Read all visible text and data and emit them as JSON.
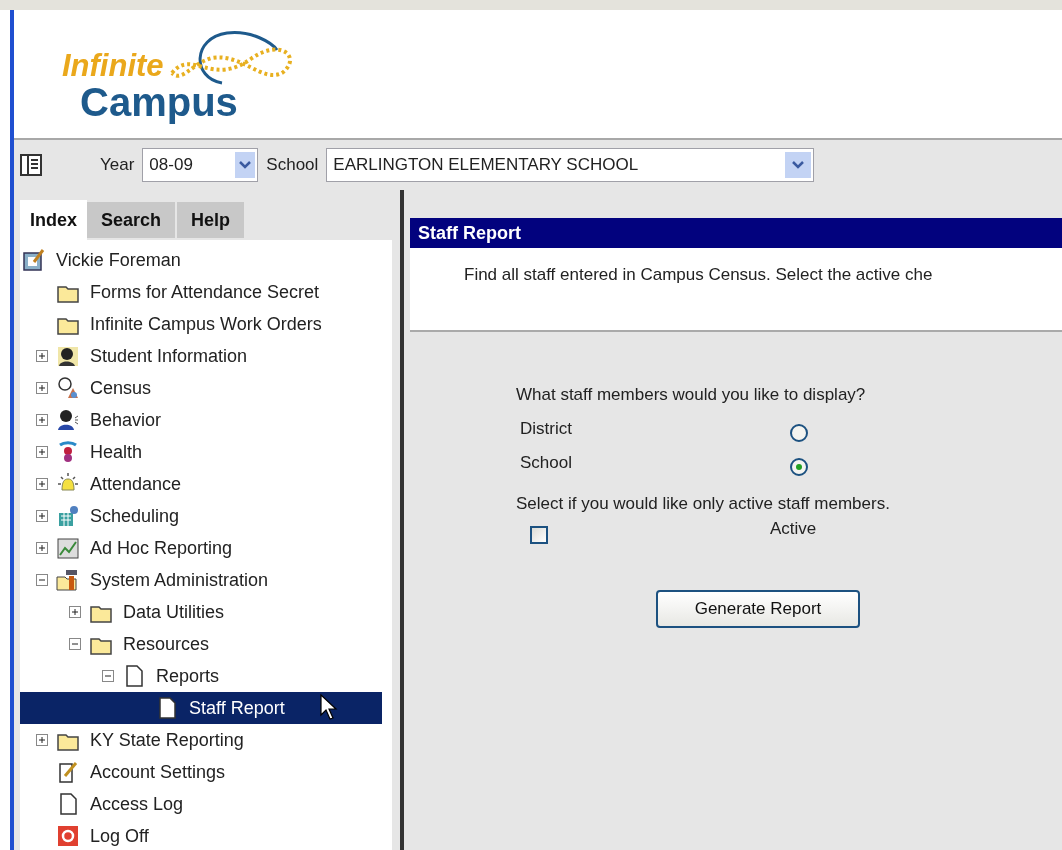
{
  "logo": {
    "line1": "Infinite",
    "line2": "Campus"
  },
  "toolbar": {
    "year_label": "Year",
    "year": "08-09",
    "school_label": "School",
    "school": "EARLINGTON ELEMENTARY SCHOOL"
  },
  "tabs": [
    {
      "label": "Index",
      "selected": true
    },
    {
      "label": "Search",
      "selected": false
    },
    {
      "label": "Help",
      "selected": false
    }
  ],
  "tree": {
    "label": "Vickie Foreman",
    "kind": "card",
    "selected": false,
    "children": [
      {
        "label": "Forms for Attendance Secret",
        "kind": "folder",
        "selected": false
      },
      {
        "label": "Infinite Campus Work Orders",
        "kind": "folder",
        "selected": false
      },
      {
        "label": "Student Information",
        "kind": "person",
        "expanded": false,
        "selected": false
      },
      {
        "label": "Census",
        "kind": "census",
        "expanded": false,
        "selected": false
      },
      {
        "label": "Behavior",
        "kind": "behavior",
        "expanded": false,
        "selected": false
      },
      {
        "label": "Health",
        "kind": "health",
        "expanded": false,
        "selected": false
      },
      {
        "label": "Attendance",
        "kind": "bell",
        "expanded": false,
        "selected": false
      },
      {
        "label": "Scheduling",
        "kind": "building",
        "expanded": false,
        "selected": false
      },
      {
        "label": "Ad Hoc Reporting",
        "kind": "chart",
        "expanded": false,
        "selected": false
      },
      {
        "label": "System Administration",
        "kind": "tools",
        "expanded": true,
        "selected": false,
        "children": [
          {
            "label": "Data Utilities",
            "kind": "folder",
            "expanded": false,
            "selected": false
          },
          {
            "label": "Resources",
            "kind": "folder",
            "expanded": true,
            "selected": false,
            "children": [
              {
                "label": "Reports",
                "kind": "doc",
                "expanded": true,
                "selected": false,
                "children": [
                  {
                    "label": "Staff Report",
                    "kind": "doc",
                    "selected": true
                  }
                ]
              }
            ]
          }
        ]
      },
      {
        "label": "KY State Reporting",
        "kind": "folder",
        "expanded": false,
        "selected": false
      },
      {
        "label": "Account Settings",
        "kind": "pencil",
        "selected": false
      },
      {
        "label": "Access Log",
        "kind": "doc",
        "selected": false
      },
      {
        "label": "Log Off",
        "kind": "power",
        "selected": false
      }
    ]
  },
  "panel": {
    "title": "Staff Report",
    "description": "Find all staff entered in Campus Census. Select the active che",
    "question": "What staff members would you like to display?",
    "options": [
      {
        "label": "District",
        "selected": false
      },
      {
        "label": "School",
        "selected": true
      }
    ],
    "active_prompt": "Select if you would like only active staff members.",
    "active": {
      "label": "Active",
      "checked": false
    },
    "button": "Generate Report"
  }
}
